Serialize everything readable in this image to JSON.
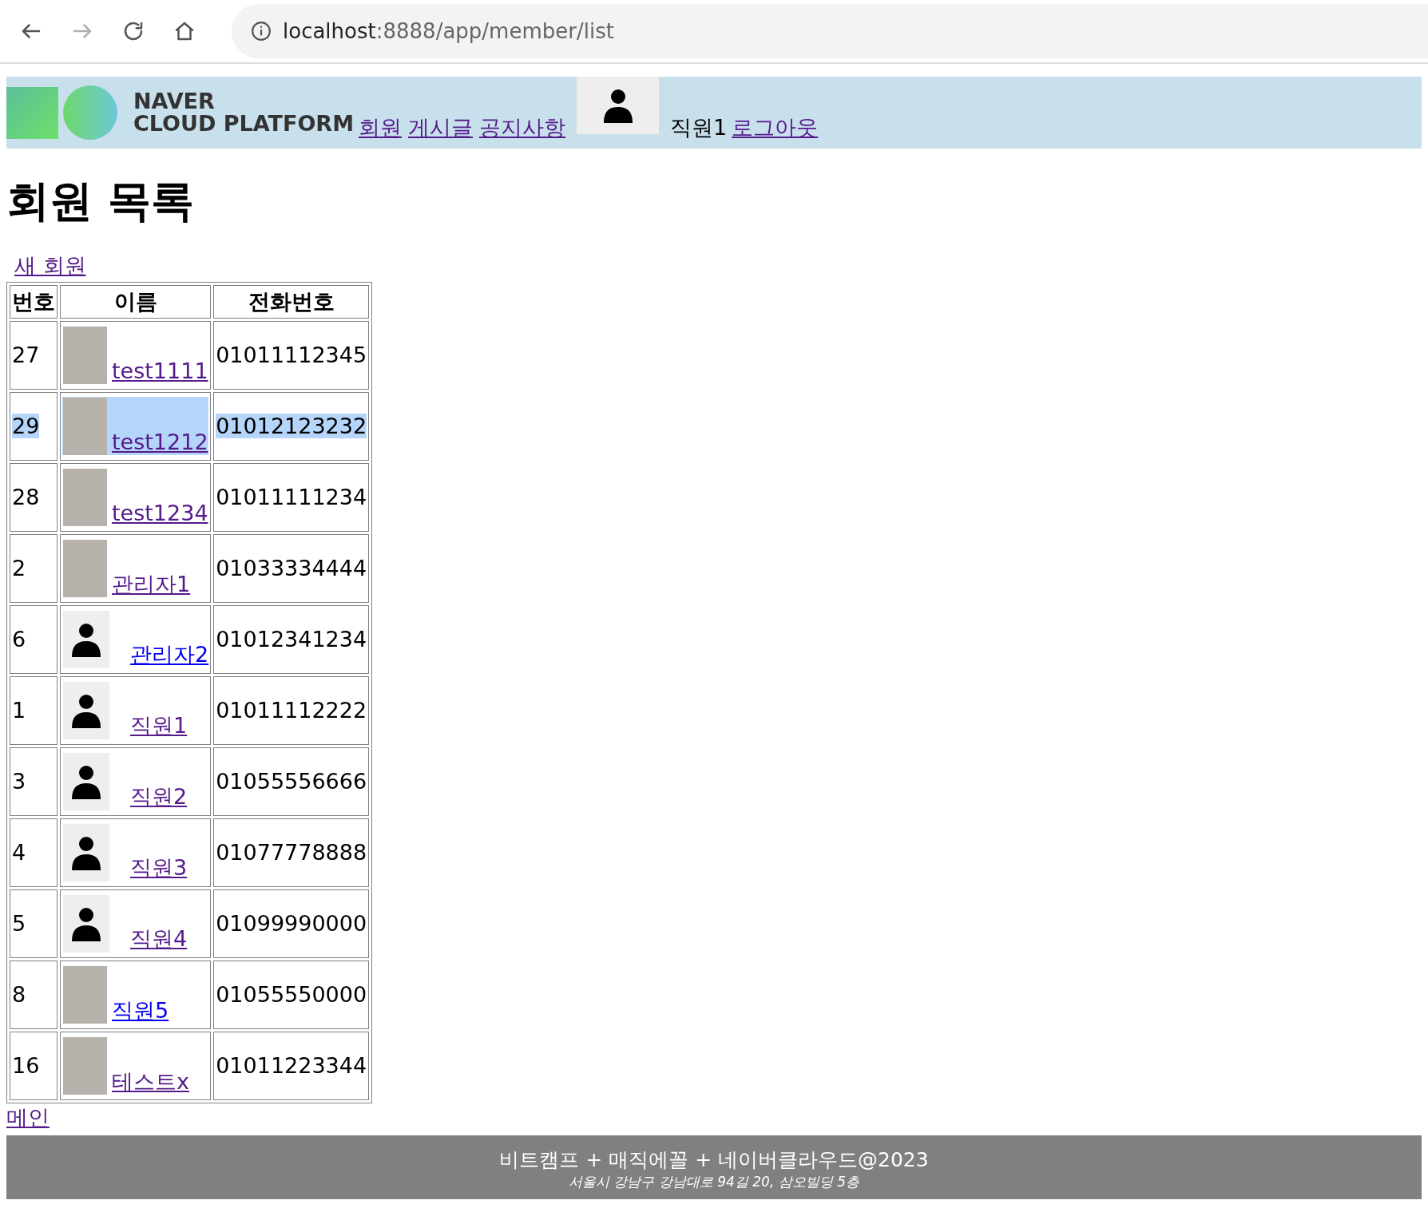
{
  "browser": {
    "url_host": "localhost",
    "url_path": ":8888/app/member/list",
    "forward_disabled": true
  },
  "header": {
    "logo_line1": "NAVER",
    "logo_line2": "CLOUD PLATFORM",
    "nav": [
      {
        "label": "회원"
      },
      {
        "label": "게시글"
      },
      {
        "label": "공지사항"
      }
    ],
    "user_name": "직원1",
    "logout": "로그아웃"
  },
  "page_title": "회원 목록",
  "new_member_link": "새 회원",
  "table": {
    "columns": [
      "번호",
      "이름",
      "전화번호"
    ],
    "rows": [
      {
        "no": "27",
        "name": "test1111",
        "phone": "01011112345",
        "kind": "photo",
        "visited": true,
        "selected": false
      },
      {
        "no": "29",
        "name": "test1212",
        "phone": "01012123232",
        "kind": "photo",
        "visited": true,
        "selected": true
      },
      {
        "no": "28",
        "name": "test1234",
        "phone": "01011111234",
        "kind": "photo",
        "visited": true,
        "selected": false
      },
      {
        "no": "2",
        "name": "관리자1",
        "phone": "01033334444",
        "kind": "photo",
        "visited": true,
        "selected": false
      },
      {
        "no": "6",
        "name": "관리자2",
        "phone": "01012341234",
        "kind": "avatar",
        "visited": false,
        "selected": false
      },
      {
        "no": "1",
        "name": "직원1",
        "phone": "01011112222",
        "kind": "avatar",
        "visited": true,
        "selected": false
      },
      {
        "no": "3",
        "name": "직원2",
        "phone": "01055556666",
        "kind": "avatar",
        "visited": true,
        "selected": false
      },
      {
        "no": "4",
        "name": "직원3",
        "phone": "01077778888",
        "kind": "avatar",
        "visited": true,
        "selected": false
      },
      {
        "no": "5",
        "name": "직원4",
        "phone": "01099990000",
        "kind": "avatar",
        "visited": true,
        "selected": false
      },
      {
        "no": "8",
        "name": "직원5",
        "phone": "01055550000",
        "kind": "photo",
        "visited": false,
        "selected": false
      },
      {
        "no": "16",
        "name": "테스트x",
        "phone": "01011223344",
        "kind": "photo",
        "visited": true,
        "selected": false
      }
    ]
  },
  "main_link": "메인",
  "footer": {
    "line1": "비트캠프 + 매직에꼴 + 네이버클라우드@2023",
    "line2": "서울시 강남구 강남대로 94길 20, 삼오빌딩 5층"
  }
}
